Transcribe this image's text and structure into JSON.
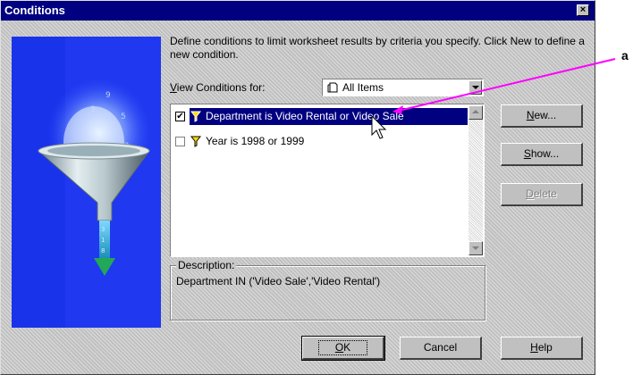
{
  "window": {
    "title": "Conditions",
    "close_glyph": "×"
  },
  "intro_text": "Define conditions to limit worksheet results by criteria you specify. Click New to define a new condition.",
  "view_conditions": {
    "label_prefix": "V",
    "label_rest": "iew Conditions for:",
    "selected_value": "All Items"
  },
  "conditions": [
    {
      "label": "Department is Video Rental or Video Sale",
      "checked": true,
      "selected": true,
      "check_glyph": "✔"
    },
    {
      "label": "Year is 1998 or 1999",
      "checked": false,
      "selected": false,
      "check_glyph": ""
    }
  ],
  "buttons": {
    "new": {
      "acc": "N",
      "rest": "ew..."
    },
    "show": {
      "acc": "S",
      "rest": "how..."
    },
    "delete": {
      "acc": "D",
      "rest": "elete"
    },
    "ok": {
      "acc": "O",
      "rest": "K"
    },
    "cancel": {
      "label": "Cancel"
    },
    "help": {
      "acc": "H",
      "rest": "elp"
    }
  },
  "description": {
    "caption": "Description:",
    "text": "Department IN ('Video Sale','Video Rental')"
  },
  "annotation": {
    "letter": "a"
  },
  "colors": {
    "title_bar": "#000080",
    "selection": "#000080",
    "dialog_face": "#c0c0c0",
    "annotation_arrow": "#ff00ff",
    "art_background": "#1a36ff"
  },
  "icons": {
    "close": "close-icon",
    "combo": "document-icon",
    "funnel": "funnel-icon",
    "cursor": "mouse-pointer-icon"
  }
}
